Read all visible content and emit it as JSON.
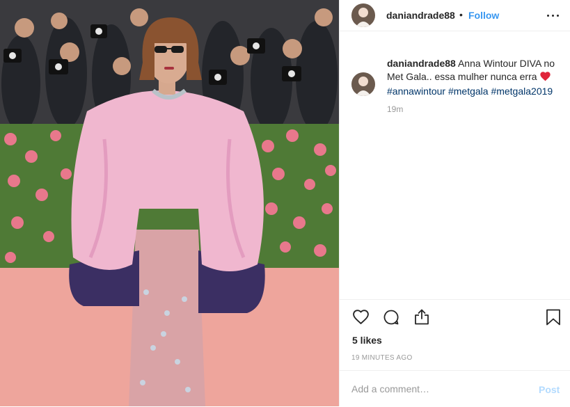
{
  "post": {
    "username": "daniandrade88",
    "separator": "•",
    "follow_label": "Follow",
    "more_icon": "more-horizontal-icon"
  },
  "caption": {
    "username": "daniandrade88",
    "text": "Anna Wintour DIVA no Met Gala.. essa mulher nunca erra",
    "emoji": "heart-emoji",
    "hashtags": [
      "#annawintour",
      "#metgala",
      "#metgala2019"
    ],
    "time": "19m"
  },
  "actions": {
    "like_icon": "heart-outline-icon",
    "comment_icon": "comment-bubble-icon",
    "share_icon": "share-icon",
    "save_icon": "bookmark-icon"
  },
  "stats": {
    "likes": "5 likes",
    "posted": "19 MINUTES AGO"
  },
  "comment": {
    "placeholder": "Add a comment…",
    "post_label": "Post"
  },
  "colors": {
    "accent": "#3897f0",
    "hashtag": "#003569",
    "post_disabled": "#b3dbff",
    "muted": "#999999",
    "heart": "#ed4956"
  }
}
